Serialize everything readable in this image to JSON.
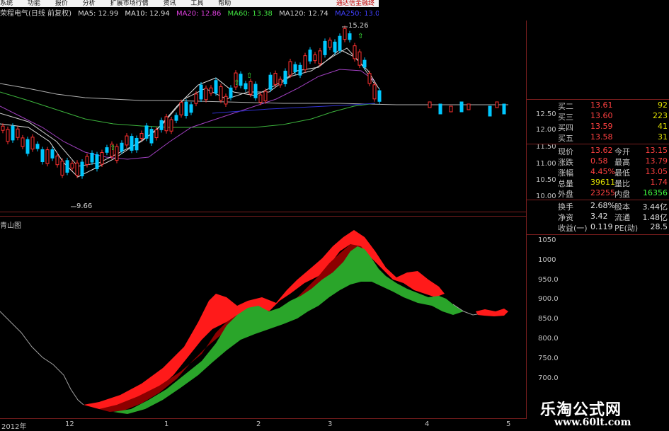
{
  "menu": {
    "items": [
      "系统",
      "功能",
      "报价",
      "分析",
      "扩展市场行情",
      "资讯",
      "工具",
      "帮助"
    ],
    "promo": "通达信金融终"
  },
  "info": {
    "title": "荣程电气(日线 前复权)",
    "ma5": "MA5: 12.99",
    "ma10": "MA10: 12.94",
    "ma20": "MA20: 12.86",
    "ma60": "MA60: 13.38",
    "ma120": "MA120: 12.74",
    "ma250": "MA250: 13.06"
  },
  "price_labels": {
    "high": "15.26",
    "low": "9.66"
  },
  "upper_axis": [
    "12.50",
    "12.00",
    "11.50",
    "11.00",
    "10.50",
    "10.00"
  ],
  "lower_indicator": {
    "name": "青山图",
    "axis": [
      "1050",
      "1000",
      "950.0",
      "900.0",
      "850.0",
      "800.0",
      "750.0",
      "700.0"
    ]
  },
  "time_axis": [
    "2012年",
    "12",
    "1",
    "2",
    "3",
    "4",
    "5"
  ],
  "quote": {
    "bid2": {
      "label": "买二",
      "price": "13.61",
      "vol": "92"
    },
    "bid3": {
      "label": "买三",
      "price": "13.60",
      "vol": "223"
    },
    "bid4": {
      "label": "买四",
      "price": "13.59",
      "vol": "41"
    },
    "bid5": {
      "label": "买五",
      "price": "13.58",
      "vol": "31"
    },
    "rows": [
      {
        "l1": "现价",
        "v1": "13.62",
        "l2": "今开",
        "v2": "13.15"
      },
      {
        "l1": "涨跌",
        "v1": "0.58",
        "l2": "最高",
        "v2": "13.79"
      },
      {
        "l1": "涨幅",
        "v1": "4.45%",
        "l2": "最低",
        "v2": "13.05"
      },
      {
        "l1": "总量",
        "v1": "39611",
        "l2": "量比",
        "v2": "1.74"
      },
      {
        "l1": "外盘",
        "v1": "23255",
        "l2": "内盘",
        "v2": "16356"
      },
      {
        "l1": "换手",
        "v1": "2.68%",
        "l2": "股本",
        "v2": "3.44亿"
      },
      {
        "l1": "净资",
        "v1": "3.42",
        "l2": "流通",
        "v2": "1.48亿"
      },
      {
        "l1": "收益(一)",
        "v1": "0.119",
        "l2": "PE(动)",
        "v2": "28.5"
      }
    ]
  },
  "watermark": {
    "cn": "乐淘公式网",
    "url": "www.60lt.com"
  },
  "colors": {
    "up": "#ff3030",
    "down": "#00c8ff",
    "green_fill": "#2aa52a",
    "red_fill": "#ff1a1a",
    "dark_red": "#8c0000",
    "label_red": "#ff4040",
    "label_green": "#40ff40"
  }
}
